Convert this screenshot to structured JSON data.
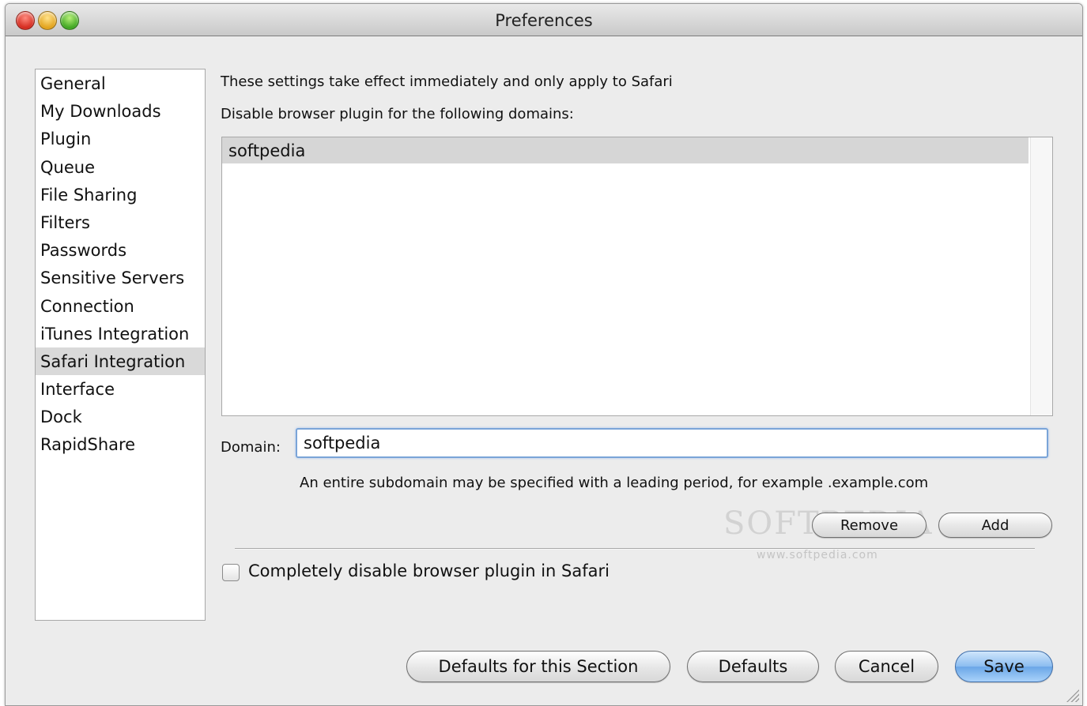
{
  "window": {
    "title": "Preferences"
  },
  "sidebar": {
    "items": [
      {
        "label": "General"
      },
      {
        "label": "My Downloads"
      },
      {
        "label": "Plugin"
      },
      {
        "label": "Queue"
      },
      {
        "label": "File Sharing"
      },
      {
        "label": "Filters"
      },
      {
        "label": "Passwords"
      },
      {
        "label": "Sensitive Servers"
      },
      {
        "label": "Connection"
      },
      {
        "label": "iTunes Integration"
      },
      {
        "label": "Safari Integration",
        "selected": true
      },
      {
        "label": "Interface"
      },
      {
        "label": "Dock"
      },
      {
        "label": "RapidShare"
      }
    ]
  },
  "main": {
    "note": "These settings take effect immediately and only apply to Safari",
    "list_caption": "Disable browser plugin for the following domains:",
    "domains": [
      "softpedia"
    ],
    "domain_label": "Domain:",
    "domain_value": "softpedia",
    "hint": "An entire subdomain may be specified with a leading period, for example .example.com",
    "remove_label": "Remove",
    "add_label": "Add",
    "checkbox_label": "Completely disable browser plugin in Safari",
    "checkbox_checked": false
  },
  "footer": {
    "defaults_section_label": "Defaults for this Section",
    "defaults_label": "Defaults",
    "cancel_label": "Cancel",
    "save_label": "Save"
  },
  "watermark": {
    "text": "SOFTPEDIA",
    "url": "www.softpedia.com"
  }
}
